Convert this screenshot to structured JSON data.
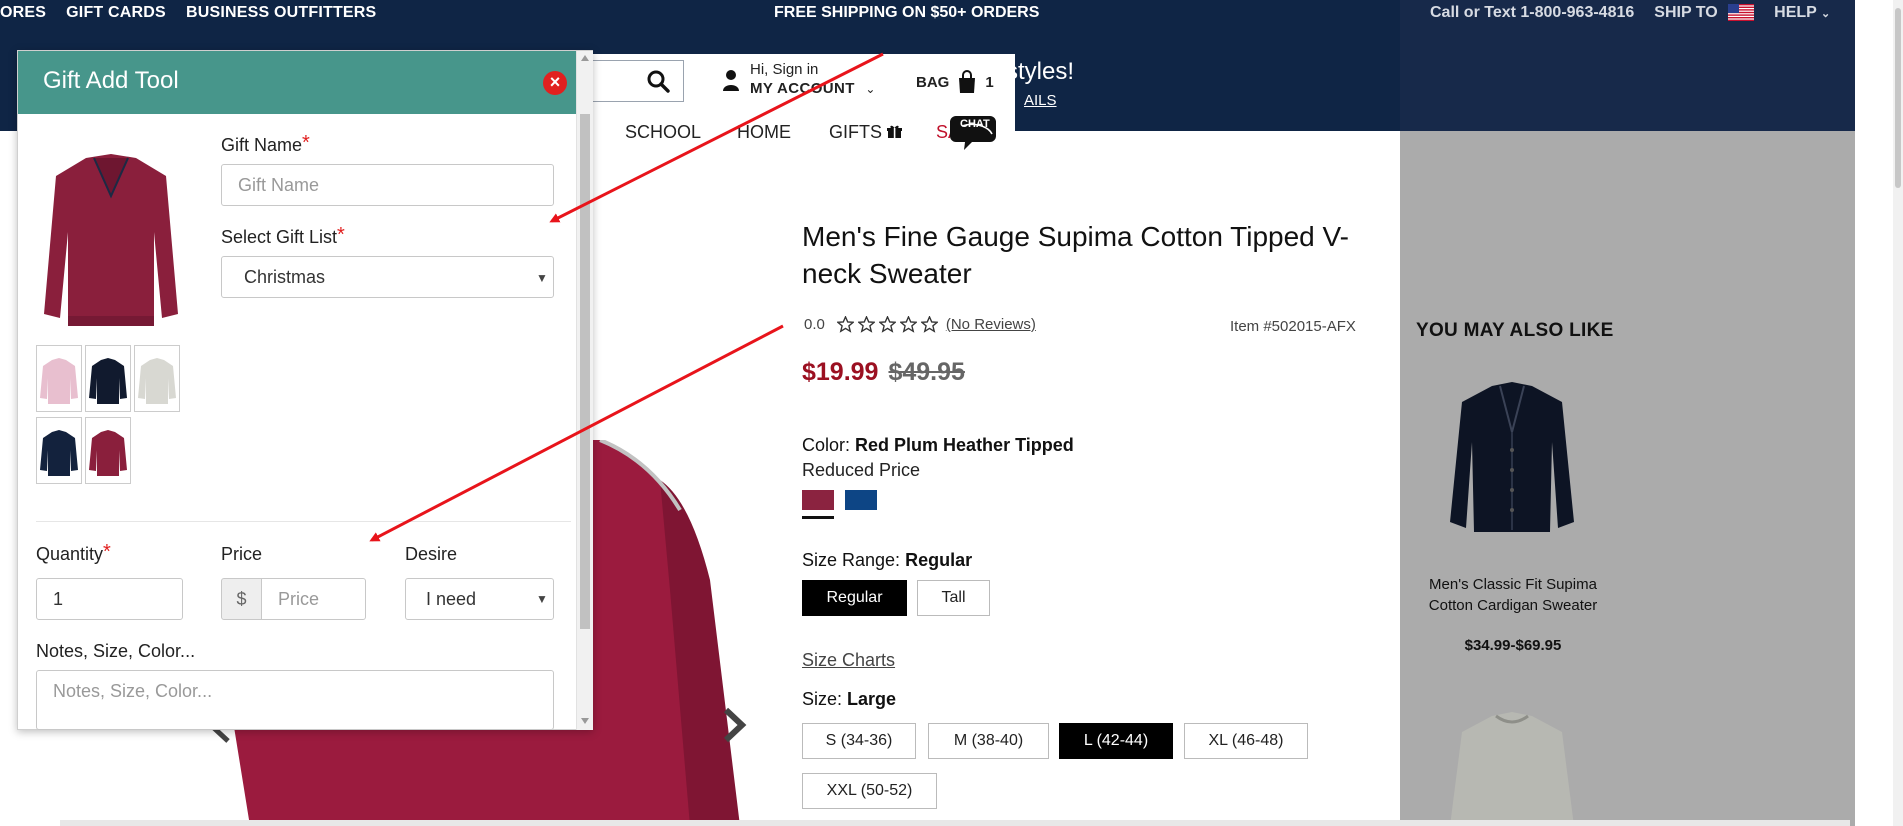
{
  "topbar": {
    "links": [
      "ORES",
      "GIFT CARDS",
      "BUSINESS OUTFITTERS"
    ],
    "promo": "FREE SHIPPING ON $50+ ORDERS",
    "phone": "Call or Text 1-800-963-4816",
    "ship_to": "SHIP TO",
    "help": "HELP",
    "promo_line_2": "styles!",
    "promo_link": "AILS"
  },
  "header": {
    "account_greeting": "Hi, Sign in",
    "account_label": "MY ACCOUNT",
    "bag_label": "BAG",
    "bag_count": "1",
    "chat_label": "CHAT"
  },
  "nav": {
    "items": [
      "SCHOOL",
      "HOME",
      "GIFTS",
      "SA"
    ]
  },
  "product": {
    "title": "Men's Fine Gauge Supima Cotton Tipped V-neck Sweater",
    "rating": "0.0",
    "reviews": "(No Reviews)",
    "item_number": "Item #502015-AFX",
    "price_sale": "$19.99",
    "price_original": "$49.95",
    "color_label": "Color:",
    "color_value": "Red Plum Heather Tipped",
    "reduced_price": "Reduced Price",
    "swatches": [
      "#8b2340",
      "#0d4585"
    ],
    "size_range_label": "Size Range:",
    "size_range_value": "Regular",
    "size_ranges": [
      "Regular",
      "Tall"
    ],
    "size_charts": "Size Charts",
    "size_label": "Size:",
    "size_value": "Large",
    "sizes": [
      "S (34-36)",
      "M (38-40)",
      "L (42-44)",
      "XL (46-48)",
      "XXL (50-52)"
    ]
  },
  "recommendations": {
    "title": "YOU MAY ALSO LIKE",
    "items": [
      {
        "name": "Men's Classic Fit Supima Cotton Cardigan Sweater",
        "price": "$34.99-$69.95"
      }
    ]
  },
  "gift_tool": {
    "title": "Gift Add Tool",
    "close_icon": "close-icon",
    "gift_name_label": "Gift Name",
    "gift_name_placeholder": "Gift Name",
    "select_list_label": "Select Gift List",
    "select_list_value": "Christmas",
    "quantity_label": "Quantity",
    "quantity_value": "1",
    "price_label": "Price",
    "price_prefix": "$",
    "price_placeholder": "Price",
    "desire_label": "Desire",
    "desire_value": "I need",
    "notes_label": "Notes, Size, Color...",
    "notes_placeholder": "Notes, Size, Color...",
    "required_mark": "*",
    "thumbnail_colors": [
      "#e8bfcf",
      "#111a2e",
      "#d8d8d2",
      "#13223d",
      "#8a1f3c"
    ]
  },
  "colors": {
    "header_navy": "#0f2545",
    "popup_teal": "#47968b",
    "sale_red": "#9b1021",
    "annotation_red": "#e8141b",
    "rec_gray": "#ababab"
  }
}
